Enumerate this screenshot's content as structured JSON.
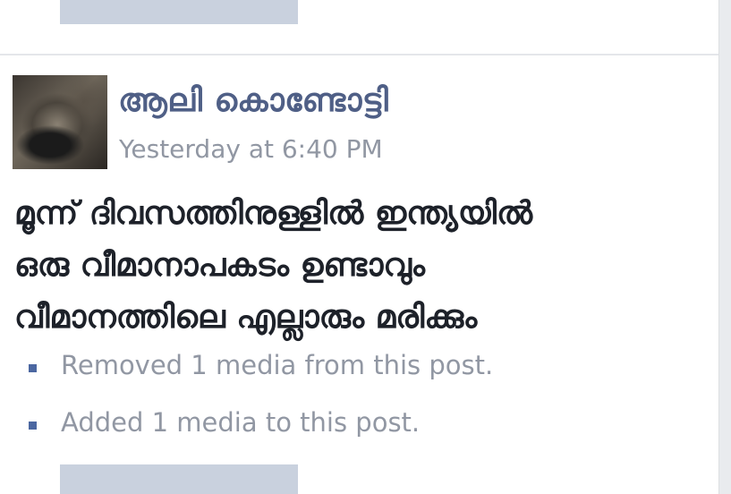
{
  "post": {
    "author_name": "ആലി കൊണ്ടോട്ടി",
    "timestamp": "Yesterday at 6:40 PM",
    "body_lines": [
      "മൂന്ന് ദിവസത്തിനുള്ളിൽ ഇന്ത്യയിൽ",
      "ഒരു വീമാനാപകടം ഉണ്ടാവും",
      "വീമാനത്തിലെ എല്ലാരും മരിക്കും"
    ],
    "edit_history": [
      "Removed 1 media from this post.",
      "Added 1 media to this post."
    ]
  },
  "colors": {
    "author_link": "#4f5f86",
    "meta_text": "#9197a3",
    "bullet": "#4b67a1",
    "placeholder_bar": "#c9d1de"
  }
}
